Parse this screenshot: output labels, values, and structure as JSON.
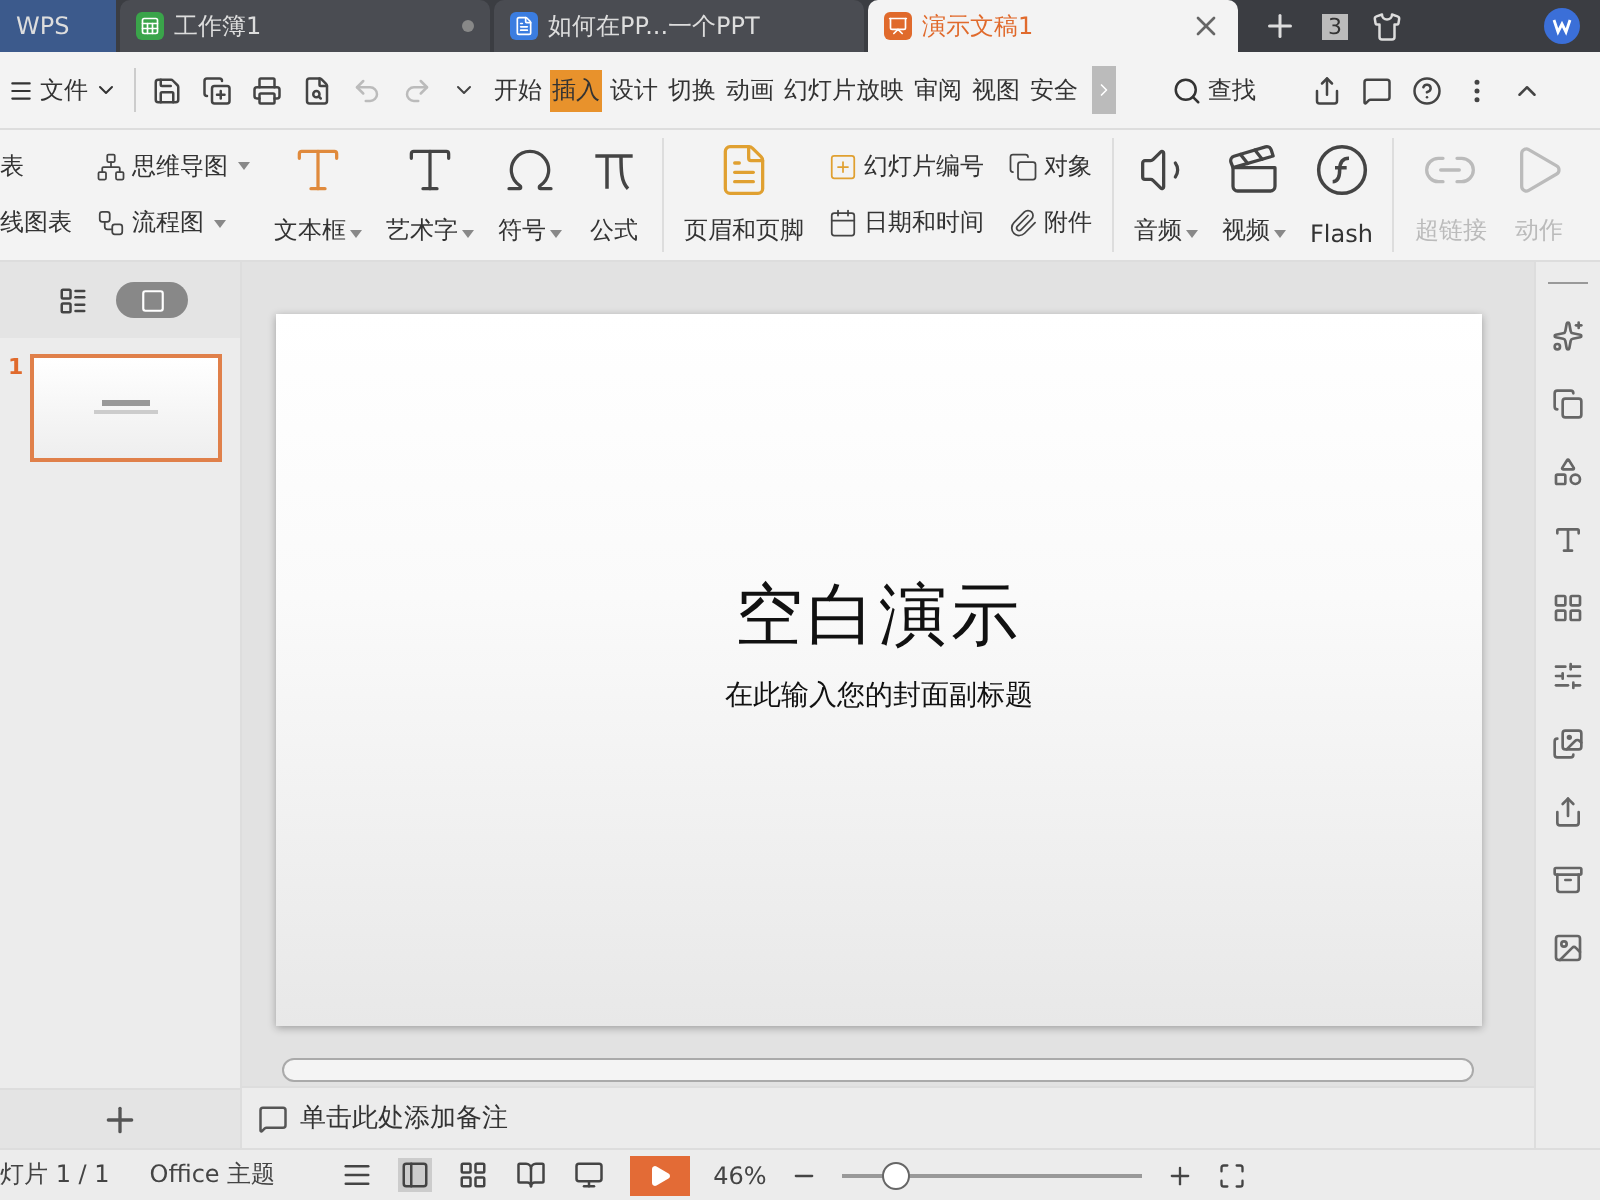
{
  "tabs": [
    {
      "kind": "home",
      "label": "WPS",
      "selected": false
    },
    {
      "kind": "sheet",
      "label": "工作簿1",
      "selected": false
    },
    {
      "kind": "doc",
      "label": "如何在PP...一个PPT",
      "selected": false
    },
    {
      "kind": "slides",
      "label": "演示文稿1",
      "selected": true
    }
  ],
  "window_count": "3",
  "menu": {
    "file_label": "文件",
    "tabs": [
      {
        "label": "开始",
        "selected": false
      },
      {
        "label": "插入",
        "selected": true
      },
      {
        "label": "设计",
        "selected": false
      },
      {
        "label": "切换",
        "selected": false
      },
      {
        "label": "动画",
        "selected": false
      },
      {
        "label": "幻灯片放映",
        "selected": false
      },
      {
        "label": "审阅",
        "selected": false
      },
      {
        "label": "视图",
        "selected": false
      },
      {
        "label": "安全",
        "selected": false
      }
    ],
    "search_label": "查找"
  },
  "ribbon": [
    {
      "kind": "pair",
      "items": [
        {
          "label": "表",
          "dropdown": false
        },
        {
          "label": "线图表",
          "dropdown": false
        }
      ]
    },
    {
      "kind": "pair",
      "items": [
        {
          "label": "思维导图",
          "dropdown": true
        },
        {
          "label": "流程图",
          "dropdown": true
        }
      ]
    },
    {
      "kind": "big",
      "label": "文本框",
      "dropdown": true,
      "disabled": false
    },
    {
      "kind": "big",
      "label": "艺术字",
      "dropdown": true,
      "disabled": false
    },
    {
      "kind": "big",
      "label": "符号",
      "dropdown": true,
      "disabled": false
    },
    {
      "kind": "big",
      "label": "公式",
      "dropdown": false,
      "disabled": false
    },
    {
      "kind": "divider"
    },
    {
      "kind": "big",
      "label": "页眉和页脚",
      "dropdown": false,
      "disabled": false
    },
    {
      "kind": "pair",
      "items": [
        {
          "label": "幻灯片编号",
          "dropdown": false
        },
        {
          "label": "日期和时间",
          "dropdown": false
        }
      ]
    },
    {
      "kind": "pair",
      "items": [
        {
          "label": "对象",
          "dropdown": false
        },
        {
          "label": "附件",
          "dropdown": false
        }
      ]
    },
    {
      "kind": "divider"
    },
    {
      "kind": "big",
      "label": "音频",
      "dropdown": true,
      "disabled": false
    },
    {
      "kind": "big",
      "label": "视频",
      "dropdown": true,
      "disabled": false
    },
    {
      "kind": "big",
      "label": "Flash",
      "dropdown": false,
      "disabled": false
    },
    {
      "kind": "divider"
    },
    {
      "kind": "big",
      "label": "超链接",
      "dropdown": false,
      "disabled": true
    },
    {
      "kind": "big",
      "label": "动作",
      "dropdown": false,
      "disabled": true
    }
  ],
  "slides": [
    {
      "number": "1",
      "selected": true
    }
  ],
  "slide": {
    "title": "空白演示",
    "subtitle": "在此输入您的封面副标题"
  },
  "notes": {
    "placeholder": "单击此处添加备注"
  },
  "status_bar": {
    "slide_position": "灯片 1 / 1",
    "theme": "Office 主题",
    "zoom": "46%",
    "zoom_slider": {
      "level": 0.18
    }
  }
}
